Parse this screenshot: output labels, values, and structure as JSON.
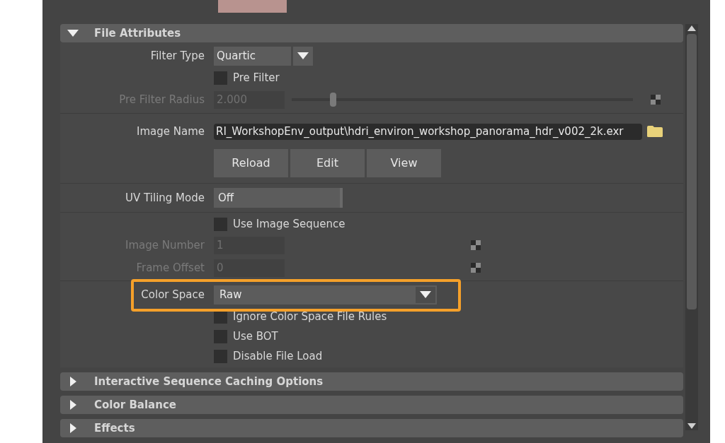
{
  "sections": [
    {
      "title": "File Attributes",
      "expanded": true,
      "groups": [
        [
          {
            "kind": "dropdown",
            "label": "Filter Type",
            "value": "Quartic",
            "disabled": false,
            "highlighted": false
          },
          {
            "kind": "checkbox",
            "label": "Pre Filter",
            "checked": false,
            "disabled": false
          },
          {
            "kind": "slider",
            "label": "Pre Filter Radius",
            "value": "2.000",
            "level": 0.12,
            "disabled": true
          }
        ],
        [
          {
            "kind": "path",
            "label": "Image Name",
            "value": "RI_WorkshopEnv_output\\hdri_environ_workshop_panorama_hdr_v002_2k.exr",
            "disabled": false
          },
          {
            "kind": "buttons",
            "buttons": [
              "Reload",
              "Edit",
              "View"
            ]
          }
        ],
        [
          {
            "kind": "field",
            "label": "UV Tiling Mode",
            "value": "Off",
            "disabled": false
          }
        ],
        [
          {
            "kind": "checkbox",
            "label": "Use Image Sequence",
            "checked": false,
            "disabled": false
          },
          {
            "kind": "mapped",
            "label": "Image Number",
            "value": "1",
            "disabled": true
          },
          {
            "kind": "mapped",
            "label": "Frame Offset",
            "value": "0",
            "disabled": true
          }
        ],
        [
          {
            "kind": "wide_dropdown",
            "label": "Color Space",
            "value": "Raw",
            "disabled": false,
            "highlighted": true
          },
          {
            "kind": "checkbox",
            "label": "Ignore Color Space File Rules",
            "checked": false,
            "disabled": false
          },
          {
            "kind": "checkbox",
            "label": "Use BOT",
            "checked": false,
            "disabled": false
          },
          {
            "kind": "checkbox",
            "label": "Disable File Load",
            "checked": false,
            "disabled": false
          }
        ]
      ]
    },
    {
      "title": "Interactive Sequence Caching Options",
      "expanded": false
    },
    {
      "title": "Color Balance",
      "expanded": false
    },
    {
      "title": "Effects",
      "expanded": false
    }
  ]
}
